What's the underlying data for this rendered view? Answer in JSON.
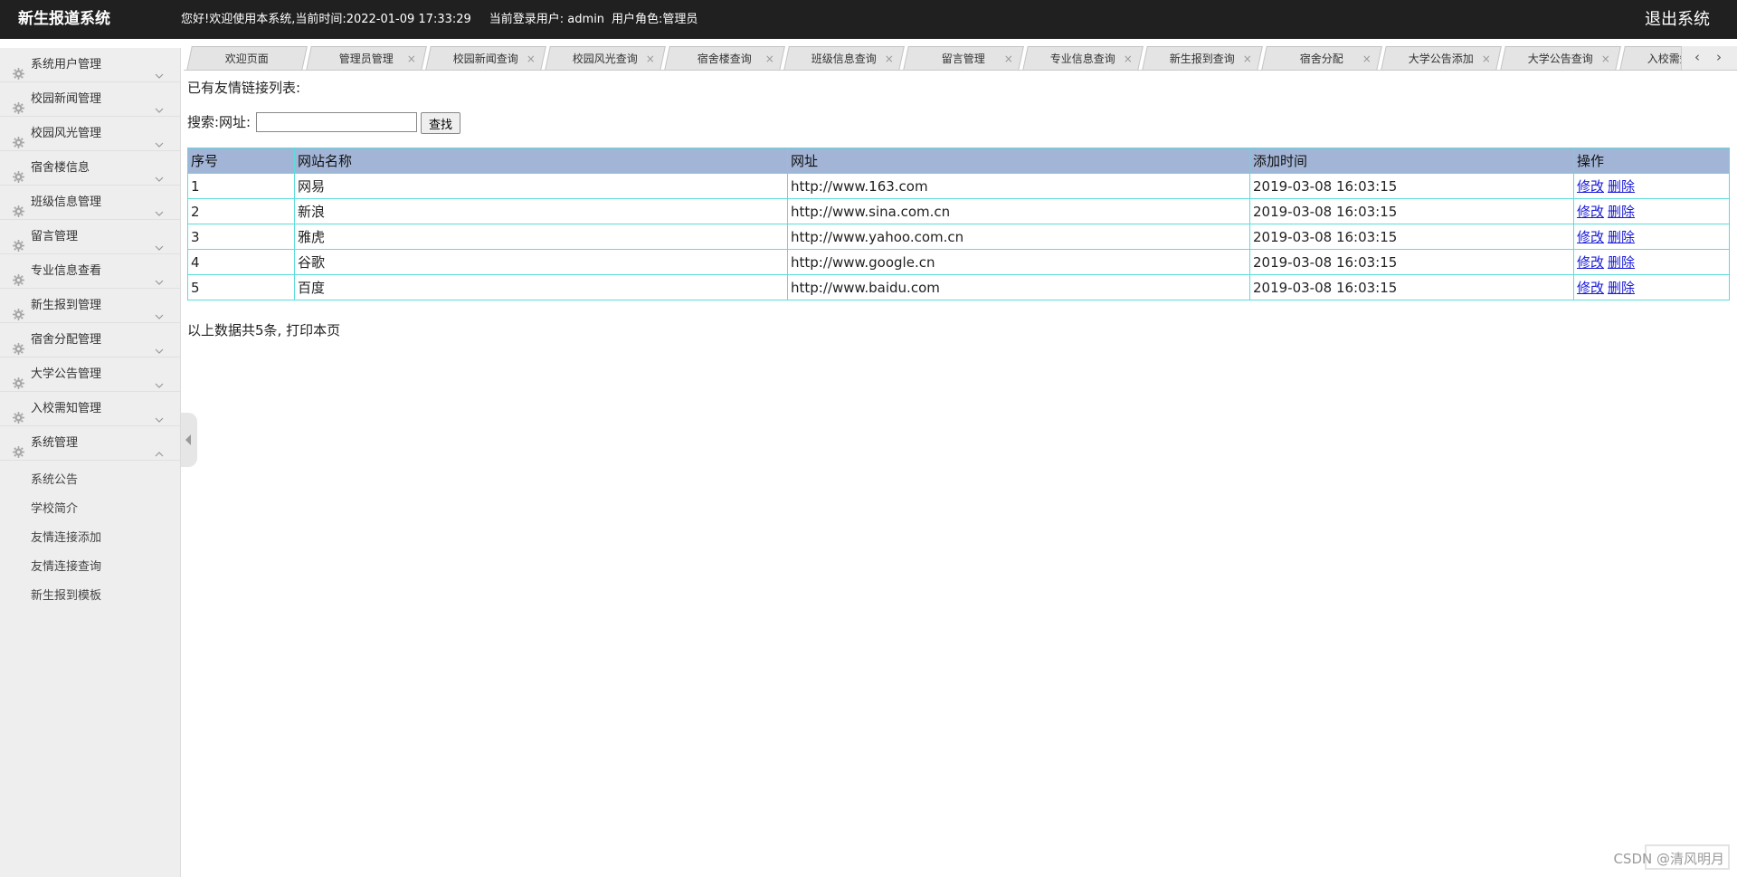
{
  "header": {
    "app_title": "新生报道系统",
    "greeting": "您好!欢迎使用本系统,当前时间:2022-01-09 17:33:29",
    "current_user": "当前登录用户: admin",
    "user_role": "用户角色:管理员",
    "logout_label": "退出系统"
  },
  "sidebar": {
    "items": [
      {
        "label": "系统用户管理"
      },
      {
        "label": "校园新闻管理"
      },
      {
        "label": "校园风光管理"
      },
      {
        "label": "宿舍楼信息"
      },
      {
        "label": "班级信息管理"
      },
      {
        "label": "留言管理"
      },
      {
        "label": "专业信息查看"
      },
      {
        "label": "新生报到管理"
      },
      {
        "label": "宿舍分配管理"
      },
      {
        "label": "大学公告管理"
      },
      {
        "label": "入校需知管理"
      },
      {
        "label": "系统管理"
      }
    ],
    "sub_items": [
      {
        "label": "系统公告"
      },
      {
        "label": "学校简介"
      },
      {
        "label": "友情连接添加"
      },
      {
        "label": "友情连接查询"
      },
      {
        "label": "新生报到模板"
      }
    ]
  },
  "tabs": [
    {
      "label": "欢迎页面"
    },
    {
      "label": "管理员管理"
    },
    {
      "label": "校园新闻查询"
    },
    {
      "label": "校园风光查询"
    },
    {
      "label": "宿舍楼查询"
    },
    {
      "label": "班级信息查询"
    },
    {
      "label": "留言管理"
    },
    {
      "label": "专业信息查询"
    },
    {
      "label": "新生报到查询"
    },
    {
      "label": "宿舍分配"
    },
    {
      "label": "大学公告添加"
    },
    {
      "label": "大学公告查询"
    },
    {
      "label": "入校需知查询"
    }
  ],
  "tab_nav": {
    "prev": "‹",
    "next": "›",
    "close": "×"
  },
  "main": {
    "list_title": "已有友情链接列表:",
    "search_label": "搜索:网址:",
    "search_value": "",
    "search_button": "查找",
    "columns": [
      "序号",
      "网站名称",
      "网址",
      "添加时间",
      "操作"
    ],
    "rows": [
      {
        "no": "1",
        "name": "网易",
        "url": "http://www.163.com",
        "time": "2019-03-08 16:03:15"
      },
      {
        "no": "2",
        "name": "新浪",
        "url": "http://www.sina.com.cn",
        "time": "2019-03-08 16:03:15"
      },
      {
        "no": "3",
        "name": "雅虎",
        "url": "http://www.yahoo.com.cn",
        "time": "2019-03-08 16:03:15"
      },
      {
        "no": "4",
        "name": "谷歌",
        "url": "http://www.google.cn",
        "time": "2019-03-08 16:03:15"
      },
      {
        "no": "5",
        "name": "百度",
        "url": "http://www.baidu.com",
        "time": "2019-03-08 16:03:15"
      }
    ],
    "edit_label": "修改",
    "delete_label": "删除",
    "summary": "以上数据共5条, 打印本页"
  },
  "watermark": "CSDN @清风明月"
}
